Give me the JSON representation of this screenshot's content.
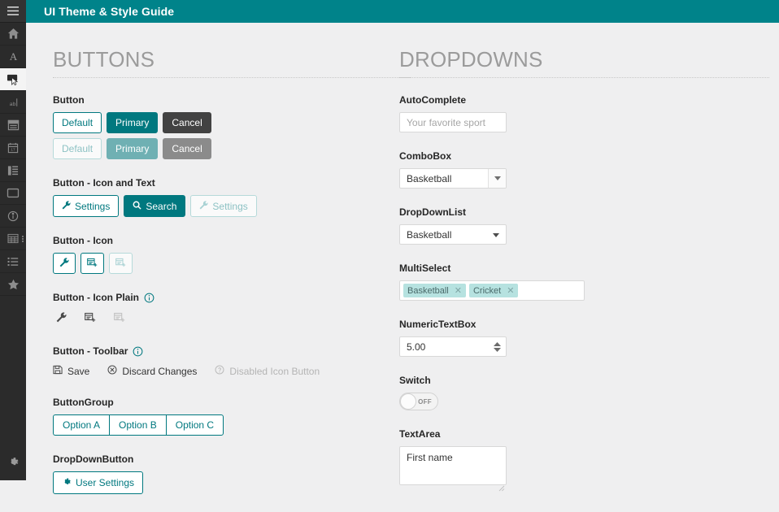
{
  "header": {
    "title": "UI Theme & Style Guide",
    "accent_color": "#00838a",
    "menu_icon": "hamburger-icon"
  },
  "sidebar": {
    "background_color": "#2b2b2b",
    "items": [
      {
        "icon": "home-icon",
        "active": false
      },
      {
        "icon": "font-letter-a-icon",
        "active": false
      },
      {
        "icon": "cursor-pointer-icon",
        "active": true
      },
      {
        "icon": "textbox-ab-icon",
        "active": false
      },
      {
        "icon": "window-panel-icon",
        "active": false
      },
      {
        "icon": "calendar-icon",
        "active": false
      },
      {
        "icon": "list-layout-icon",
        "active": false
      },
      {
        "icon": "dialog-box-icon",
        "active": false
      },
      {
        "icon": "info-circle-icon",
        "active": false
      },
      {
        "icon": "grid-table-icon",
        "active": false,
        "has_overflow_dots": true
      },
      {
        "icon": "bullet-list-icon",
        "active": false
      },
      {
        "icon": "star-icon",
        "active": false
      }
    ],
    "footer_item": {
      "icon": "gear-icon"
    }
  },
  "buttons_section": {
    "title": "BUTTONS",
    "button_group_label": "Button",
    "row_enabled": [
      {
        "label": "Default",
        "style": "default"
      },
      {
        "label": "Primary",
        "style": "primary"
      },
      {
        "label": "Cancel",
        "style": "cancel"
      }
    ],
    "row_disabled": [
      {
        "label": "Default",
        "style": "default"
      },
      {
        "label": "Primary",
        "style": "primary"
      },
      {
        "label": "Cancel",
        "style": "cancel"
      }
    ],
    "icon_text_label": "Button - Icon and Text",
    "icon_text_buttons": [
      {
        "label": "Settings",
        "icon": "wrench-icon",
        "style": "default"
      },
      {
        "label": "Search",
        "icon": "search-icon",
        "style": "primary"
      },
      {
        "label": "Settings",
        "icon": "wrench-icon",
        "style": "default-disabled"
      }
    ],
    "icon_only_label": "Button - Icon",
    "icon_only_buttons": [
      {
        "icon": "wrench-icon",
        "state": "enabled"
      },
      {
        "icon": "add-record-icon",
        "state": "enabled"
      },
      {
        "icon": "add-record-icon",
        "state": "disabled"
      }
    ],
    "icon_plain_label": "Button - Icon Plain",
    "icon_plain_info_icon": "info-circle-icon",
    "icon_plain_buttons": [
      {
        "icon": "wrench-icon",
        "state": "enabled"
      },
      {
        "icon": "add-record-icon",
        "state": "enabled"
      },
      {
        "icon": "add-record-icon",
        "state": "disabled"
      }
    ],
    "toolbar_label": "Button - Toolbar",
    "toolbar_info_icon": "info-circle-icon",
    "toolbar_buttons": [
      {
        "label": "Save",
        "icon": "save-disk-icon",
        "state": "enabled"
      },
      {
        "label": "Discard Changes",
        "icon": "cancel-circle-icon",
        "state": "enabled"
      },
      {
        "label": "Disabled Icon Button",
        "icon": "question-circle-icon",
        "state": "disabled"
      }
    ],
    "button_group_title": "ButtonGroup",
    "group_options": [
      "Option A",
      "Option B",
      "Option C"
    ],
    "dropdown_button_label": "DropDownButton",
    "dropdown_button": {
      "label": "User Settings",
      "icon": "gear-icon"
    }
  },
  "dropdowns_section": {
    "title": "DROPDOWNS",
    "autocomplete": {
      "label": "AutoComplete",
      "value": "",
      "placeholder": "Your favorite sport"
    },
    "combobox": {
      "label": "ComboBox",
      "value": "Basketball",
      "arrow_icon": "chevron-down-icon"
    },
    "dropdownlist": {
      "label": "DropDownList",
      "value": "Basketball",
      "arrow_icon": "chevron-down-icon"
    },
    "multiselect": {
      "label": "MultiSelect",
      "chips": [
        {
          "label": "Basketball",
          "remove_icon": "close-icon"
        },
        {
          "label": "Cricket",
          "remove_icon": "close-icon"
        }
      ]
    },
    "numerictextbox": {
      "label": "NumericTextBox",
      "value": "5.00",
      "spinner_icon": "spinner-up-down-icon"
    },
    "switch": {
      "label": "Switch",
      "state_label": "OFF",
      "checked": false
    },
    "textarea": {
      "label": "TextArea",
      "value": "First name",
      "resize_icon": "resize-grip-icon"
    }
  }
}
